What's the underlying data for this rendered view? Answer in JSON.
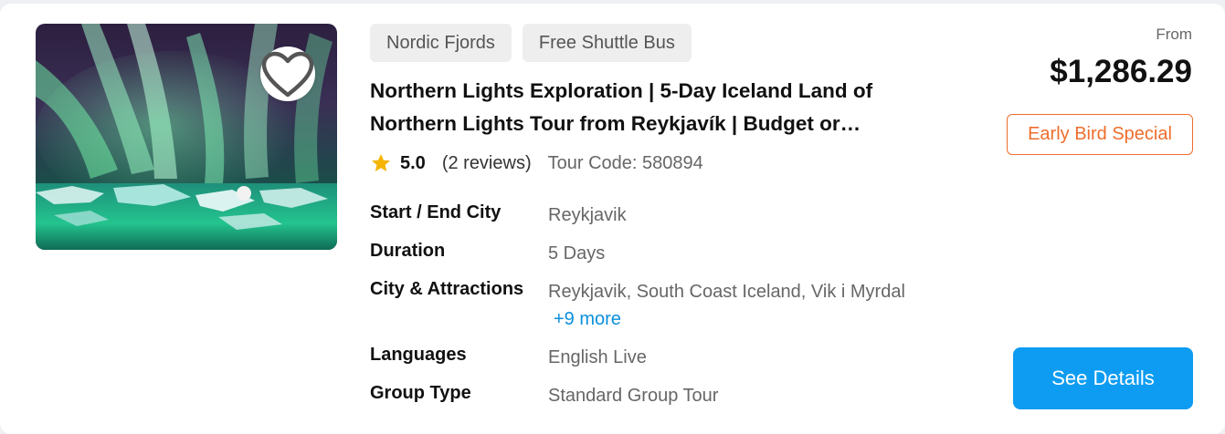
{
  "tour": {
    "tags": [
      "Nordic Fjords",
      "Free Shuttle Bus"
    ],
    "title_line1": "Northern Lights Exploration | 5-Day Iceland Land of",
    "title_line2": "Northern Lights Tour from Reykjavík | Budget or…",
    "rating": {
      "score": "5.0",
      "reviews": "(2 reviews)",
      "code_label": "Tour Code:",
      "code": "580894"
    },
    "details": [
      {
        "label": "Start / End City",
        "value": "Reykjavik"
      },
      {
        "label": "Duration",
        "value": "5 Days"
      },
      {
        "label": "City & Attractions",
        "value": "Reykjavik, South Coast Iceland, Vik i Myrdal",
        "more": "+9 more"
      },
      {
        "label": "Languages",
        "value": "English Live"
      },
      {
        "label": "Group Type",
        "value": "Standard Group Tour"
      }
    ]
  },
  "pricing": {
    "from_label": "From",
    "price": "$1,286.29",
    "badge": "Early Bird Special",
    "cta": "See Details"
  },
  "colors": {
    "accent_blue": "#0d9cf2",
    "badge_orange": "#ee6d2c",
    "star": "#f5b400",
    "link": "#0a8fdc"
  },
  "icons": {
    "favorite": "heart-outline-icon",
    "rating": "star-icon"
  }
}
